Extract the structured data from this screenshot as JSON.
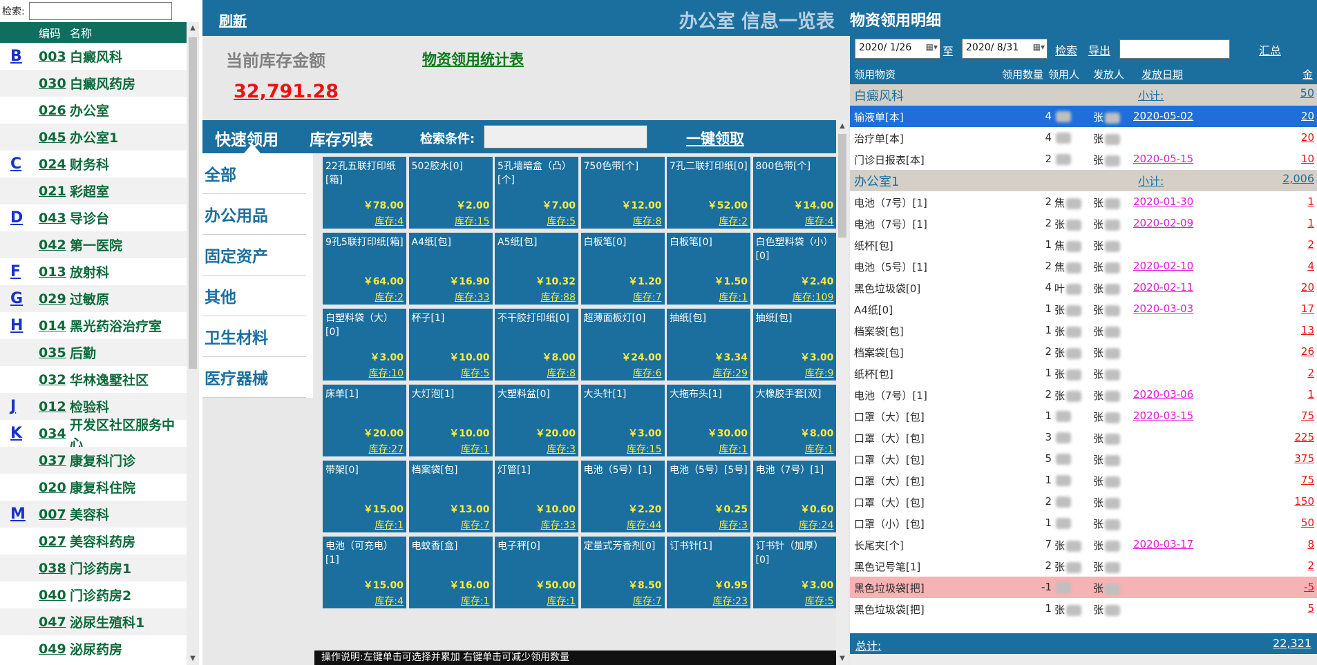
{
  "left": {
    "search_label": "检索:",
    "search_value": "",
    "col_code": "编码",
    "col_name": "名称",
    "items": [
      {
        "letter": "B",
        "code": "003",
        "name": "白癜风科"
      },
      {
        "letter": "",
        "code": "030",
        "name": "白癜风药房"
      },
      {
        "letter": "",
        "code": "026",
        "name": "办公室"
      },
      {
        "letter": "",
        "code": "045",
        "name": "办公室1"
      },
      {
        "letter": "C",
        "code": "024",
        "name": "财务科"
      },
      {
        "letter": "",
        "code": "021",
        "name": "彩超室"
      },
      {
        "letter": "D",
        "code": "043",
        "name": "导诊台"
      },
      {
        "letter": "",
        "code": "042",
        "name": "第一医院"
      },
      {
        "letter": "F",
        "code": "013",
        "name": "放射科"
      },
      {
        "letter": "G",
        "code": "029",
        "name": "过敏原"
      },
      {
        "letter": "H",
        "code": "014",
        "name": "黑光药浴治疗室"
      },
      {
        "letter": "",
        "code": "035",
        "name": "后勤"
      },
      {
        "letter": "",
        "code": "032",
        "name": "华林逸墅社区"
      },
      {
        "letter": "J",
        "code": "012",
        "name": "检验科"
      },
      {
        "letter": "K",
        "code": "034",
        "name": "开发区社区服务中心"
      },
      {
        "letter": "",
        "code": "037",
        "name": "康复科门诊"
      },
      {
        "letter": "",
        "code": "020",
        "name": "康复科住院"
      },
      {
        "letter": "M",
        "code": "007",
        "name": "美容科"
      },
      {
        "letter": "",
        "code": "027",
        "name": "美容科药房"
      },
      {
        "letter": "",
        "code": "038",
        "name": "门诊药房1"
      },
      {
        "letter": "",
        "code": "040",
        "name": "门诊药房2"
      },
      {
        "letter": "",
        "code": "047",
        "name": "泌尿生殖科1"
      },
      {
        "letter": "",
        "code": "049",
        "name": "泌尿药房"
      }
    ]
  },
  "middle": {
    "refresh": "刷新",
    "title": "办公室 信息一览表",
    "stock_label": "当前库存金额",
    "stat_link": "物资领用统计表",
    "stock_value": "32,791.28",
    "tab_quick": "快速领用",
    "tab_stock": "库存列表",
    "cond_label": "检索条件:",
    "cond_value": "",
    "oneclick": "一键领取",
    "categories": [
      "全部",
      "办公用品",
      "固定资产",
      "其他",
      "卫生材料",
      "医疗器械"
    ],
    "help": "操作说明:左键单击可选择并累加   右键单击可减少领用数量",
    "tiles": [
      {
        "name": "22孔五联打印纸[箱]",
        "price": "￥78.00",
        "stock": "库存:4"
      },
      {
        "name": "502胶水[0]",
        "price": "￥2.00",
        "stock": "库存:15"
      },
      {
        "name": "5孔墙暗盒（凸）[个]",
        "price": "￥7.00",
        "stock": "库存:5"
      },
      {
        "name": "750色带[个]",
        "price": "￥12.00",
        "stock": "库存:8"
      },
      {
        "name": "7孔二联打印纸[0]",
        "price": "￥52.00",
        "stock": "库存:2"
      },
      {
        "name": "800色带[个]",
        "price": "￥14.00",
        "stock": "库存:4"
      },
      {
        "name": "9孔5联打印纸[箱]",
        "price": "￥64.00",
        "stock": "库存:2"
      },
      {
        "name": "A4纸[包]",
        "price": "￥16.90",
        "stock": "库存:33"
      },
      {
        "name": "A5纸[包]",
        "price": "￥10.32",
        "stock": "库存:88"
      },
      {
        "name": "白板笔[0]",
        "price": "￥1.20",
        "stock": "库存:7"
      },
      {
        "name": "白板笔[0]",
        "price": "￥1.50",
        "stock": "库存:1"
      },
      {
        "name": "白色塑料袋（小）[0]",
        "price": "￥2.40",
        "stock": "库存:109"
      },
      {
        "name": "白塑料袋（大）[0]",
        "price": "￥3.00",
        "stock": "库存:10"
      },
      {
        "name": "杯子[1]",
        "price": "￥10.00",
        "stock": "库存:5"
      },
      {
        "name": "不干胶打印纸[0]",
        "price": "￥8.00",
        "stock": "库存:8"
      },
      {
        "name": "超薄面板灯[0]",
        "price": "￥24.00",
        "stock": "库存:6"
      },
      {
        "name": "抽纸[包]",
        "price": "￥3.34",
        "stock": "库存:29"
      },
      {
        "name": "抽纸[包]",
        "price": "￥3.00",
        "stock": "库存:9"
      },
      {
        "name": "床单[1]",
        "price": "￥20.00",
        "stock": "库存:27"
      },
      {
        "name": "大灯泡[1]",
        "price": "￥10.00",
        "stock": "库存:1"
      },
      {
        "name": "大塑料盆[0]",
        "price": "￥20.00",
        "stock": "库存:3"
      },
      {
        "name": "大头针[1]",
        "price": "￥3.00",
        "stock": "库存:15"
      },
      {
        "name": "大拖布头[1]",
        "price": "￥30.00",
        "stock": "库存:1"
      },
      {
        "name": "大橡胶手套[双]",
        "price": "￥8.00",
        "stock": "库存:1"
      },
      {
        "name": "带架[0]",
        "price": "￥15.00",
        "stock": "库存:1"
      },
      {
        "name": "档案袋[包]",
        "price": "￥13.00",
        "stock": "库存:7"
      },
      {
        "name": "灯管[1]",
        "price": "￥10.00",
        "stock": "库存:33"
      },
      {
        "name": "电池（5号）[1]",
        "price": "￥2.20",
        "stock": "库存:44"
      },
      {
        "name": "电池（5号）[5号]",
        "price": "￥0.25",
        "stock": "库存:3"
      },
      {
        "name": "电池（7号）[1]",
        "price": "￥0.60",
        "stock": "库存:24"
      },
      {
        "name": "电池（可充电）[1]",
        "price": "￥15.00",
        "stock": "库存:4"
      },
      {
        "name": "电蚊香[盒]",
        "price": "￥16.00",
        "stock": "库存:1"
      },
      {
        "name": "电子秤[0]",
        "price": "￥50.00",
        "stock": "库存:1"
      },
      {
        "name": "定量式芳香剂[0]",
        "price": "￥8.50",
        "stock": "库存:7"
      },
      {
        "name": "订书针[1]",
        "price": "￥0.95",
        "stock": "库存:23"
      },
      {
        "name": "订书针（加厚）[0]",
        "price": "￥3.00",
        "stock": "库存:5"
      }
    ]
  },
  "right": {
    "title": "物资领用明细",
    "date_from": "2020/ 1/26",
    "to_label": "至",
    "date_to": "2020/ 8/31",
    "search": "检索",
    "export": "导出",
    "filter_value": "",
    "sum": "汇总",
    "headers": {
      "item": "领用物资",
      "qty": "领用数量",
      "user": "领用人",
      "issuer": "发放人",
      "date": "发放日期",
      "amount": "金"
    },
    "rows": [
      {
        "type": "group",
        "item": "白癜风科",
        "sub_label": "小计:",
        "amount": "50"
      },
      {
        "type": "sel",
        "item": "输液单[本]",
        "qty": "4",
        "user": "",
        "issuer": "张",
        "date": "2020-05-02",
        "amount": "20"
      },
      {
        "type": "row",
        "item": "治疗单[本]",
        "qty": "4",
        "user": "",
        "issuer": "张",
        "date": "",
        "amount": "20"
      },
      {
        "type": "row",
        "item": "门诊日报表[本]",
        "qty": "2",
        "user": "",
        "issuer": "张",
        "date": "2020-05-15",
        "amount": "10"
      },
      {
        "type": "group",
        "item": "办公室1",
        "sub_label": "小计:",
        "amount": "2,006"
      },
      {
        "type": "row",
        "item": "电池（7号）[1]",
        "qty": "2",
        "user": "焦",
        "issuer": "张",
        "date": "2020-01-30",
        "amount": "1"
      },
      {
        "type": "row",
        "item": "电池（7号）[1]",
        "qty": "2",
        "user": "张",
        "issuer": "张",
        "date": "2020-02-09",
        "amount": "1"
      },
      {
        "type": "row",
        "item": "纸杯[包]",
        "qty": "1",
        "user": "焦",
        "issuer": "张",
        "date": "",
        "amount": "2"
      },
      {
        "type": "row",
        "item": "电池（5号）[1]",
        "qty": "2",
        "user": "焦",
        "issuer": "张",
        "date": "2020-02-10",
        "amount": "4"
      },
      {
        "type": "row",
        "item": "黑色垃圾袋[0]",
        "qty": "4",
        "user": "叶",
        "issuer": "张",
        "date": "2020-02-11",
        "amount": "20"
      },
      {
        "type": "row",
        "item": "A4纸[0]",
        "qty": "1",
        "user": "张",
        "issuer": "张",
        "date": "2020-03-03",
        "amount": "17"
      },
      {
        "type": "row",
        "item": "档案袋[包]",
        "qty": "1",
        "user": "张",
        "issuer": "张",
        "date": "",
        "amount": "13"
      },
      {
        "type": "row",
        "item": "档案袋[包]",
        "qty": "2",
        "user": "张",
        "issuer": "张",
        "date": "",
        "amount": "26"
      },
      {
        "type": "row",
        "item": "纸杯[包]",
        "qty": "1",
        "user": "张",
        "issuer": "张",
        "date": "",
        "amount": "2"
      },
      {
        "type": "row",
        "item": "电池（7号）[1]",
        "qty": "2",
        "user": "张",
        "issuer": "张",
        "date": "2020-03-06",
        "amount": "1"
      },
      {
        "type": "row",
        "item": "口罩（大）[包]",
        "qty": "1",
        "user": "",
        "issuer": "张",
        "date": "2020-03-15",
        "amount": "75"
      },
      {
        "type": "row",
        "item": "口罩（大）[包]",
        "qty": "3",
        "user": "",
        "issuer": "张",
        "date": "",
        "amount": "225"
      },
      {
        "type": "row",
        "item": "口罩（大）[包]",
        "qty": "5",
        "user": "",
        "issuer": "张",
        "date": "",
        "amount": "375"
      },
      {
        "type": "row",
        "item": "口罩（大）[包]",
        "qty": "1",
        "user": "",
        "issuer": "张",
        "date": "",
        "amount": "75"
      },
      {
        "type": "row",
        "item": "口罩（大）[包]",
        "qty": "2",
        "user": "",
        "issuer": "张",
        "date": "",
        "amount": "150"
      },
      {
        "type": "row",
        "item": "口罩（小）[包]",
        "qty": "1",
        "user": "",
        "issuer": "张",
        "date": "",
        "amount": "50"
      },
      {
        "type": "row",
        "item": "长尾夹[个]",
        "qty": "7",
        "user": "张",
        "issuer": "张",
        "date": "2020-03-17",
        "amount": "8"
      },
      {
        "type": "row",
        "item": "黑色记号笔[1]",
        "qty": "2",
        "user": "张",
        "issuer": "张",
        "date": "",
        "amount": "2"
      },
      {
        "type": "neg",
        "item": "黑色垃圾袋[把]",
        "qty": "-1",
        "user": "",
        "issuer": "张",
        "date": "",
        "amount": "-5"
      },
      {
        "type": "row",
        "item": "黑色垃圾袋[把]",
        "qty": "1",
        "user": "张",
        "issuer": "张",
        "date": "",
        "amount": "5"
      }
    ],
    "total_label": "总计:",
    "total_value": "22,321"
  },
  "colors": {
    "primary": "#1b6f9e",
    "left_header": "#0f6e5e",
    "code_green": "#0c6a3a",
    "letter_blue": "#1733c7",
    "price_yellow": "#ffeb3b",
    "alert_red": "#e11111",
    "date_magenta": "#e11bdb",
    "selected_row": "#1e6fd9",
    "negative_row": "#f5b3b3",
    "group_row": "#d4d0c8"
  }
}
